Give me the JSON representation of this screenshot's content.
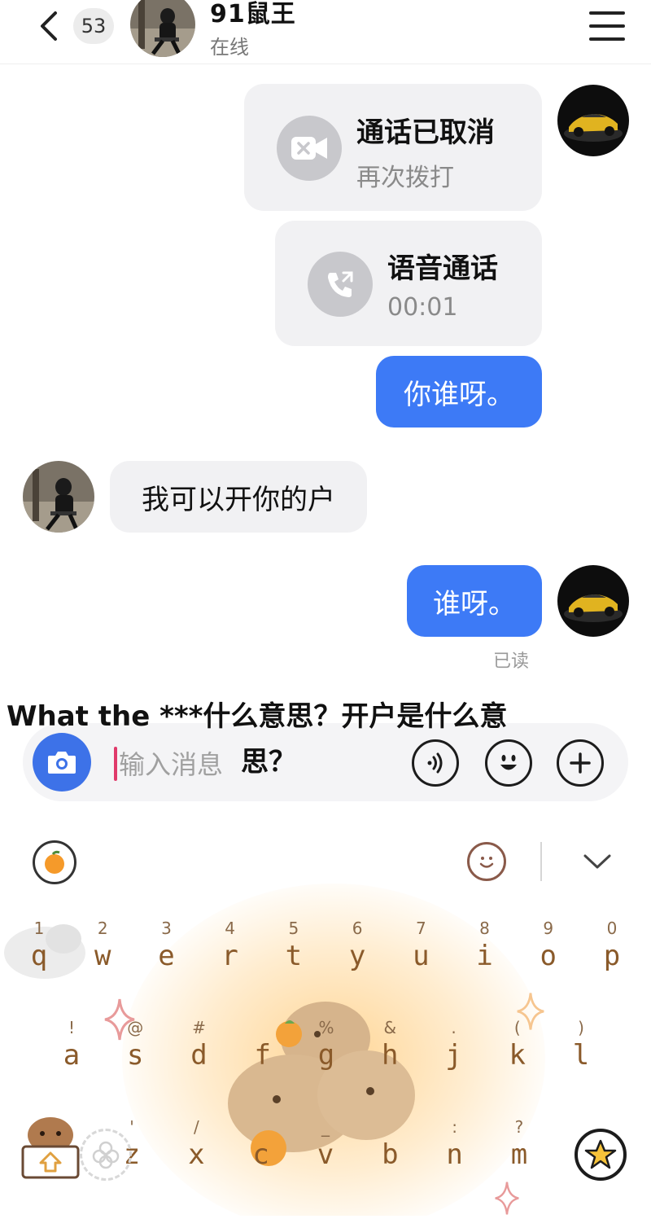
{
  "header": {
    "unread_count": "53",
    "contact_name": "91鼠王",
    "contact_status": "在线"
  },
  "messages": {
    "video_call": {
      "title": "通话已取消",
      "subtitle": "再次拨打"
    },
    "voice_call": {
      "title": "语音通话",
      "duration": "00:01"
    },
    "sent_1": "你谁呀。",
    "received_1": "我可以开你的户",
    "sent_2": "谁呀。",
    "read_receipt": "已读"
  },
  "caption": {
    "line1": "What the ***什么意思？开户是什么意",
    "line2": "思？"
  },
  "input": {
    "placeholder": "输入消息"
  },
  "keyboard": {
    "row1": [
      {
        "num": "1",
        "ch": "q"
      },
      {
        "num": "2",
        "ch": "w"
      },
      {
        "num": "3",
        "ch": "e"
      },
      {
        "num": "4",
        "ch": "r"
      },
      {
        "num": "5",
        "ch": "t"
      },
      {
        "num": "6",
        "ch": "y"
      },
      {
        "num": "7",
        "ch": "u"
      },
      {
        "num": "8",
        "ch": "i"
      },
      {
        "num": "9",
        "ch": "o"
      },
      {
        "num": "0",
        "ch": "p"
      }
    ],
    "row2": [
      {
        "num": "!",
        "ch": "a"
      },
      {
        "num": "@",
        "ch": "s"
      },
      {
        "num": "#",
        "ch": "d"
      },
      {
        "num": "",
        "ch": "f"
      },
      {
        "num": "%",
        "ch": "g"
      },
      {
        "num": "&",
        "ch": "h"
      },
      {
        "num": ".",
        "ch": "j"
      },
      {
        "num": "(",
        "ch": "k"
      },
      {
        "num": ")",
        "ch": "l"
      }
    ],
    "row3": [
      {
        "num": "'",
        "ch": "z"
      },
      {
        "num": "/",
        "ch": "x"
      },
      {
        "num": "",
        "ch": "c"
      },
      {
        "num": "_",
        "ch": "v"
      },
      {
        "num": "",
        "ch": "b"
      },
      {
        "num": ":",
        "ch": "n"
      },
      {
        "num": "?",
        "ch": "m"
      }
    ]
  },
  "colors": {
    "accent_blue": "#3d7af6",
    "bubble_gray": "#f1f1f3",
    "key_text": "#8a5a2a"
  }
}
